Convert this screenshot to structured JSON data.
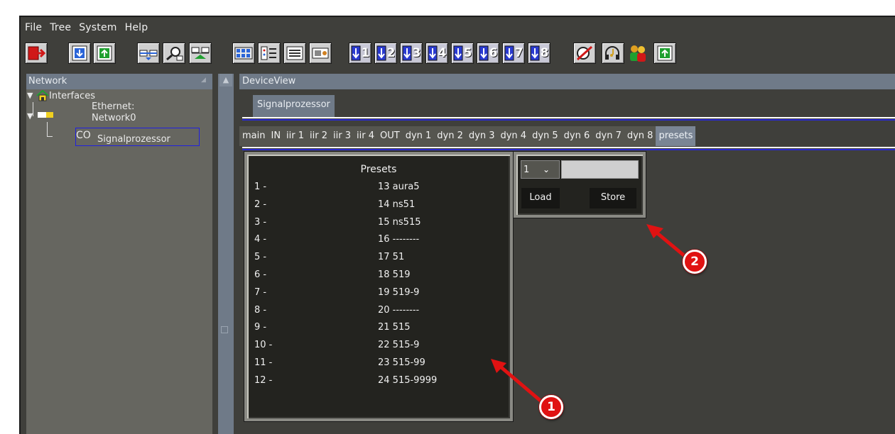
{
  "menu": [
    "File",
    "Tree",
    "System",
    "Help"
  ],
  "toolbar": {
    "icons": [
      "exit-icon",
      "download-icon",
      "upload-icon",
      "network-connect-icon",
      "network-search-icon",
      "network-tree-icon",
      "device-grid-icon",
      "tree-list-icon",
      "list-view-icon",
      "monitor-icon"
    ],
    "preset_buttons": [
      "1",
      "2",
      "3",
      "4",
      "5",
      "6",
      "7",
      "8"
    ],
    "right_icons": [
      "mute-icon",
      "headphones-icon",
      "users-icon",
      "upload-green-icon"
    ]
  },
  "network_panel": {
    "title": "Network",
    "interfaces_label": "Interfaces",
    "ethernet_line1": "Ethernet:",
    "ethernet_line2": "Network0",
    "device_prefix": "CO",
    "device_name": "Signalprozessor"
  },
  "device_view": {
    "title": "DeviceView",
    "device_tab": "Signalprozessor",
    "tabs": [
      "main",
      "IN",
      "iir 1",
      "iir 2",
      "iir 3",
      "iir 4",
      "OUT",
      "dyn 1",
      "dyn 2",
      "dyn 3",
      "dyn 4",
      "dyn 5",
      "dyn 6",
      "dyn 7",
      "dyn 8",
      "presets"
    ],
    "active_tab": "presets"
  },
  "presets": {
    "title": "Presets",
    "left": [
      "1  -",
      "2  -",
      "3  -",
      "4  -",
      "5  -",
      "6  -",
      "7  -",
      "8  -",
      "9  -",
      "10 -",
      "11 -",
      "12 -"
    ],
    "right": [
      "13 aura5",
      "14 ns51",
      "15 ns515",
      "16 --------",
      "17 51",
      "18 519",
      "19 519-9",
      "20 --------",
      "21 515",
      "22 515-9",
      "23 515-99",
      "24 515-9999"
    ]
  },
  "load_store": {
    "selected": "1",
    "input_value": "",
    "load_label": "Load",
    "store_label": "Store"
  },
  "callouts": {
    "one": "1",
    "two": "2",
    "color": "#e01212"
  }
}
